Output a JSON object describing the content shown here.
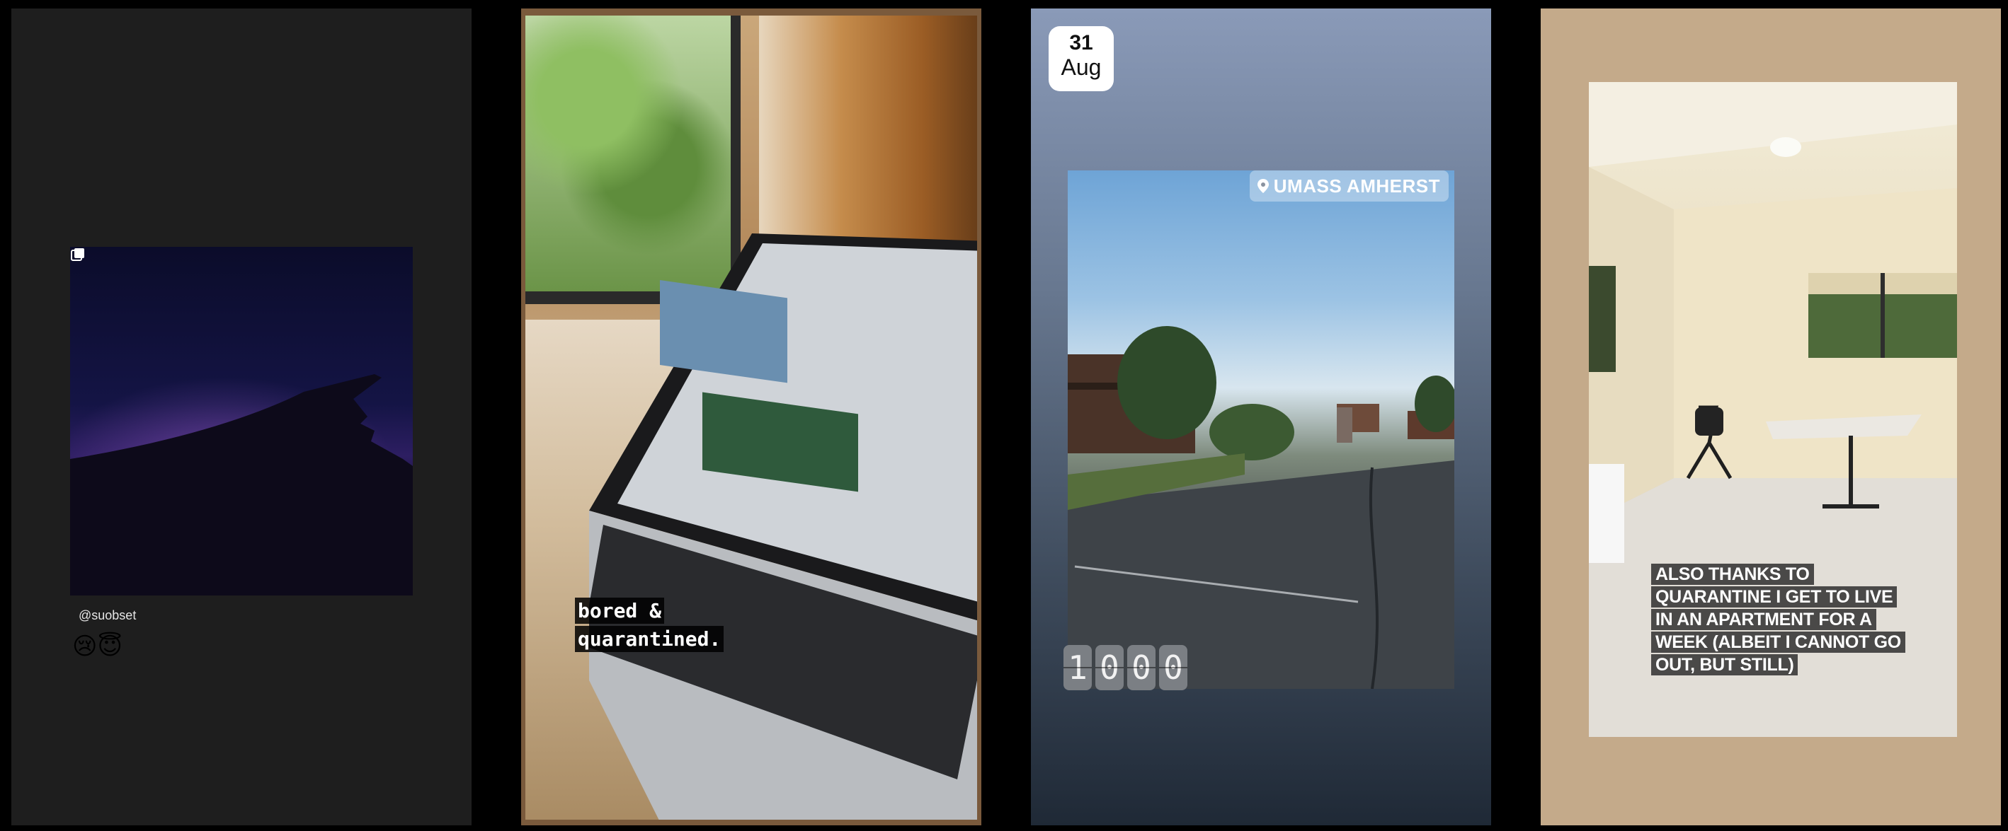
{
  "stories": [
    {
      "handle": "@suobset",
      "emojis": "😢😇",
      "icons": [
        "multiple-photos-icon"
      ]
    },
    {
      "caption_line1": "bored &",
      "caption_line2": "quarantined."
    },
    {
      "date_day": "31",
      "date_month": "Aug",
      "location": "UMASS AMHERST",
      "clock_digits": [
        "1",
        "0",
        "0",
        "0"
      ],
      "icons": [
        "location-pin-icon"
      ]
    },
    {
      "caption": "ALSO THANKS TO QUARANTINE I GET TO LIVE IN AN APARTMENT FOR A WEEK (ALBEIT I CANNOT GO OUT, BUT STILL)"
    }
  ],
  "colors": {
    "story1_bg": "#1e1e1e",
    "story2_border": "#7a5a3c",
    "story3_gradient_top": "#8a9ab8",
    "story3_gradient_bottom": "#1f2936",
    "story4_bg": "#c4aa8a"
  }
}
